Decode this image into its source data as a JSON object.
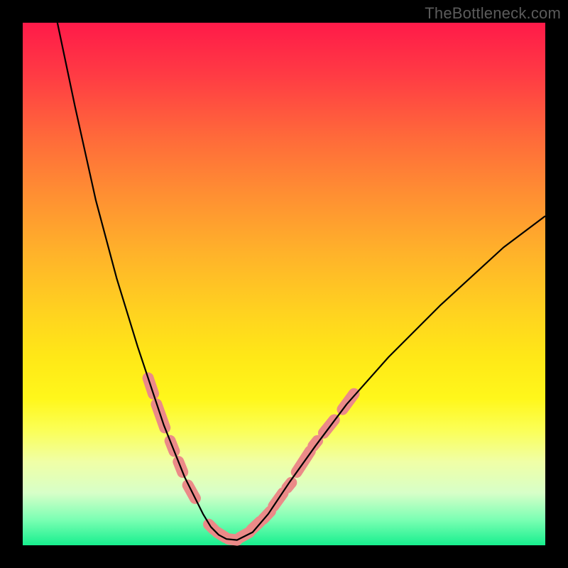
{
  "watermark": "TheBottleneck.com",
  "colors": {
    "frame": "#000000",
    "curve": "#000000",
    "marker": "#eb8a88",
    "gradient_stops": [
      {
        "pct": 0,
        "hex": "#ff1a49"
      },
      {
        "pct": 10,
        "hex": "#ff3b44"
      },
      {
        "pct": 22,
        "hex": "#ff6a3a"
      },
      {
        "pct": 32,
        "hex": "#ff8c33"
      },
      {
        "pct": 44,
        "hex": "#ffb22a"
      },
      {
        "pct": 56,
        "hex": "#ffd41f"
      },
      {
        "pct": 64,
        "hex": "#ffe817"
      },
      {
        "pct": 72,
        "hex": "#fff71b"
      },
      {
        "pct": 78,
        "hex": "#fbff57"
      },
      {
        "pct": 84,
        "hex": "#f0ffa6"
      },
      {
        "pct": 90,
        "hex": "#d7ffc8"
      },
      {
        "pct": 95,
        "hex": "#7dffb4"
      },
      {
        "pct": 100,
        "hex": "#17ef8e"
      }
    ]
  },
  "chart_data": {
    "type": "line",
    "title": "",
    "xlabel": "",
    "ylabel": "",
    "xlim": [
      0,
      100
    ],
    "ylim": [
      0,
      100
    ],
    "series": [
      {
        "name": "curve",
        "x": [
          6,
          10,
          14,
          18,
          22,
          25,
          27,
          29,
          31,
          33,
          34.5,
          36,
          37.5,
          39,
          41,
          44,
          47,
          51,
          56,
          62,
          70,
          80,
          92,
          100
        ],
        "y": [
          103,
          84,
          66,
          51,
          38,
          29,
          23,
          18,
          13,
          9,
          6,
          3.5,
          2,
          1.2,
          1,
          2.5,
          6,
          12,
          19,
          27,
          36,
          46,
          57,
          63
        ]
      }
    ],
    "markers": {
      "name": "highlight-segments",
      "segments": [
        {
          "x": [
            24.0,
            25.0
          ],
          "y": [
            32.0,
            29.0
          ]
        },
        {
          "x": [
            25.6,
            27.2
          ],
          "y": [
            27.0,
            22.5
          ]
        },
        {
          "x": [
            28.2,
            29.0
          ],
          "y": [
            20.0,
            18.0
          ]
        },
        {
          "x": [
            29.8,
            30.6
          ],
          "y": [
            16.0,
            14.0
          ]
        },
        {
          "x": [
            31.6,
            33.0
          ],
          "y": [
            11.5,
            9.0
          ]
        },
        {
          "x": [
            35.6,
            36.6
          ],
          "y": [
            4.0,
            3.0
          ]
        },
        {
          "x": [
            37.2,
            38.8
          ],
          "y": [
            2.5,
            1.5
          ]
        },
        {
          "x": [
            39.4,
            41.0
          ],
          "y": [
            1.2,
            1.0
          ]
        },
        {
          "x": [
            41.6,
            43.4
          ],
          "y": [
            1.5,
            2.5
          ]
        },
        {
          "x": [
            43.8,
            45.4
          ],
          "y": [
            3.0,
            4.5
          ]
        },
        {
          "x": [
            46.0,
            47.4
          ],
          "y": [
            5.0,
            6.5
          ]
        },
        {
          "x": [
            48.0,
            49.8
          ],
          "y": [
            7.5,
            10.0
          ]
        },
        {
          "x": [
            50.6,
            51.4
          ],
          "y": [
            11.0,
            12.0
          ]
        },
        {
          "x": [
            52.4,
            55.0
          ],
          "y": [
            14.0,
            18.0
          ]
        },
        {
          "x": [
            55.6,
            56.4
          ],
          "y": [
            19.0,
            20.0
          ]
        },
        {
          "x": [
            57.6,
            59.6
          ],
          "y": [
            21.5,
            24.0
          ]
        },
        {
          "x": [
            61.2,
            63.4
          ],
          "y": [
            26.0,
            29.0
          ]
        }
      ]
    }
  }
}
